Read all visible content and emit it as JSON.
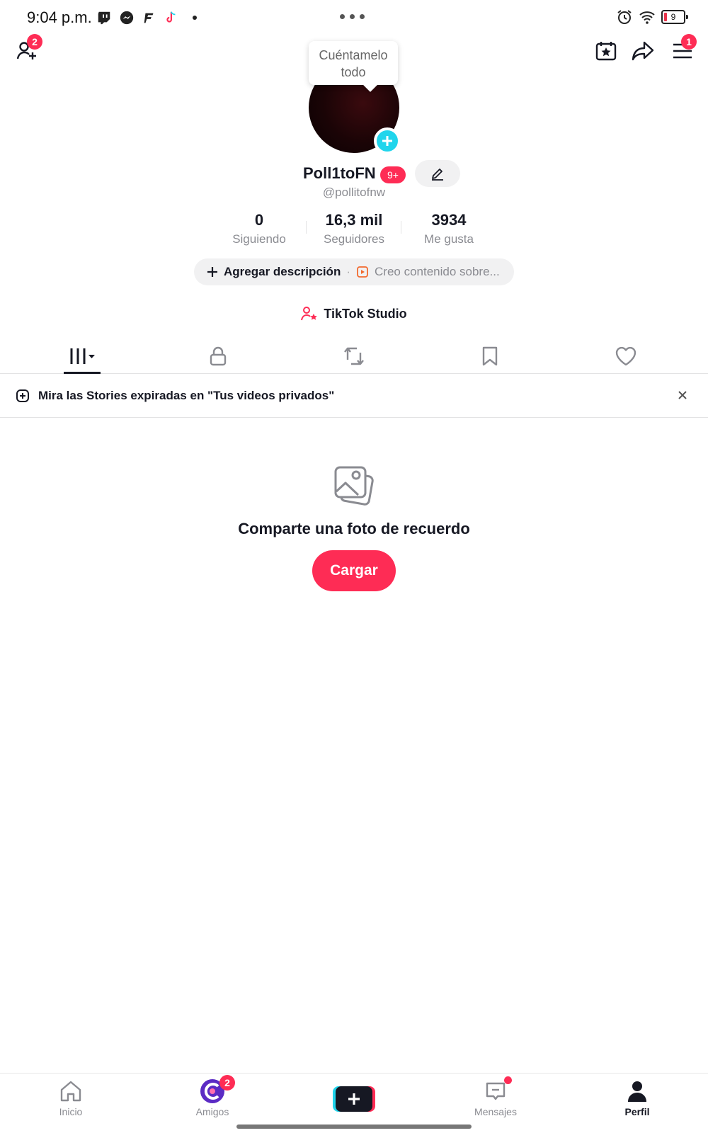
{
  "status_bar": {
    "time": "9:04 p.m.",
    "battery_level": "9",
    "app_icons": [
      "twitch-icon",
      "messenger-icon",
      "fortnite-icon",
      "tiktok-icon"
    ]
  },
  "top_bar": {
    "add_friends_badge": "2",
    "menu_badge": "1"
  },
  "profile": {
    "tooltip": "Cuéntamelo todo",
    "display_name": "Poll1toFN",
    "name_badge": "9+",
    "username": "@pollitofnw",
    "stats": [
      {
        "value": "0",
        "label": "Siguiendo"
      },
      {
        "value": "16,3 mil",
        "label": "Seguidores"
      },
      {
        "value": "3934",
        "label": "Me gusta"
      }
    ],
    "add_description": "Agregar descripción",
    "description_hint": "Creo contenido sobre...",
    "studio_link": "TikTok Studio"
  },
  "tabs": {
    "items": [
      "videos-grid",
      "private-lock",
      "reposts",
      "favorites-bookmark",
      "liked-heart"
    ],
    "active": "videos-grid"
  },
  "banner": {
    "text": "Mira las Stories expiradas en \"Tus videos privados\""
  },
  "empty_state": {
    "title": "Comparte una foto de recuerdo",
    "button": "Cargar"
  },
  "bottom_nav": {
    "items": [
      {
        "label": "Inicio"
      },
      {
        "label": "Amigos",
        "badge": "2"
      },
      {
        "label": "Mensajes"
      },
      {
        "label": "Perfil"
      }
    ],
    "active": "Perfil"
  },
  "colors": {
    "accent": "#fe2c55",
    "cyan": "#20d5ec",
    "text": "#161823",
    "muted": "#8a8b91"
  }
}
